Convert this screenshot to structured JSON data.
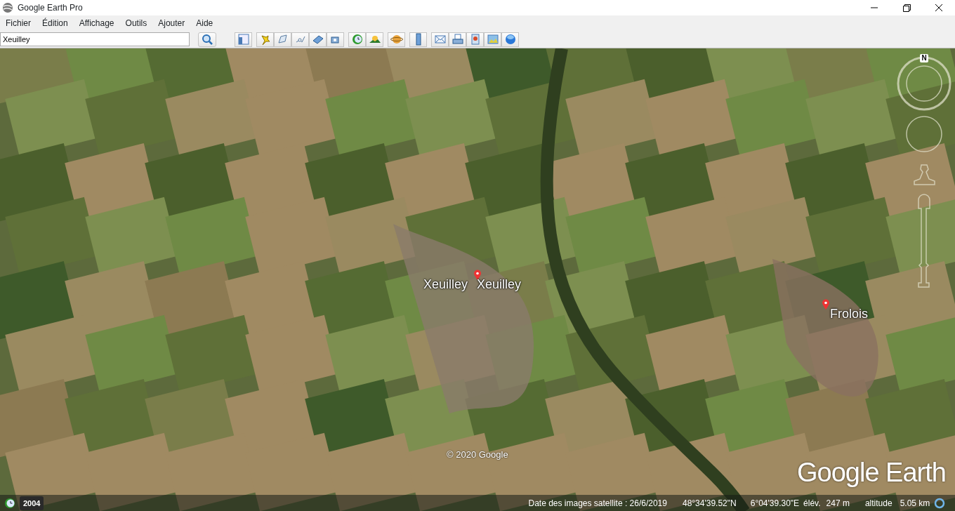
{
  "window": {
    "title": "Google Earth Pro"
  },
  "menu": [
    "Fichier",
    "Édition",
    "Affichage",
    "Outils",
    "Ajouter",
    "Aide"
  ],
  "search": {
    "value": "Xeuilley"
  },
  "map": {
    "labels": [
      {
        "text": "Xeuilley",
        "pin": true
      },
      {
        "text": "Xeuilley",
        "pin": false
      },
      {
        "text": "Frolois",
        "pin": true
      }
    ],
    "copyright": "© 2020 Google",
    "logo": "Google Earth",
    "compass_north": "N",
    "historical_year": "2004"
  },
  "status_bar": {
    "imagery_date": "Date des images satellite : 26/6/2019",
    "latitude": "48°34'39.52\"N",
    "longitude": "6°04'39.30\"E",
    "elevation_label": "élév.",
    "elevation": "247 m",
    "altitude_label": "altitude",
    "altitude": "5.05 km"
  }
}
